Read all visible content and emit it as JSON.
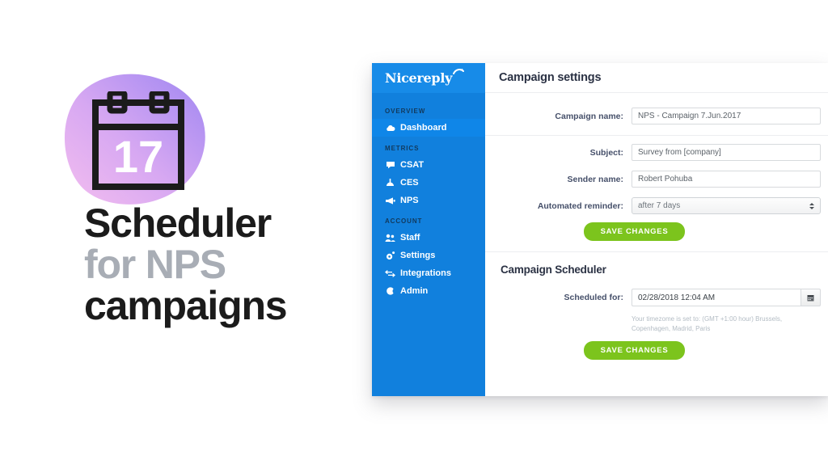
{
  "promo": {
    "calendar_day": "17",
    "headline_line1": "Scheduler",
    "headline_line2": "for NPS",
    "headline_line3": "campaigns",
    "colors": {
      "blob_pink": "#f0b9ec",
      "blob_purple": "#a28cf0",
      "headline_dark": "#1b1b1b",
      "headline_gray": "#a8adb5"
    }
  },
  "app": {
    "brand": {
      "name": "Nicereply"
    },
    "colors": {
      "sidebar_blue": "#1180dd",
      "brand_blue": "#178be8",
      "active_blue": "#0f86e8",
      "save_green": "#7cc41d",
      "title_navy": "#2b3244"
    },
    "sidebar": {
      "sections": [
        {
          "label": "OVERVIEW",
          "items": [
            {
              "label": "Dashboard",
              "icon": "cloud-icon",
              "active": true
            }
          ]
        },
        {
          "label": "METRICS",
          "items": [
            {
              "label": "CSAT",
              "icon": "speech-bubble-icon",
              "active": false
            },
            {
              "label": "CES",
              "icon": "gauge-icon",
              "active": false
            },
            {
              "label": "NPS",
              "icon": "megaphone-icon",
              "active": false
            }
          ]
        },
        {
          "label": "ACCOUNT",
          "items": [
            {
              "label": "Staff",
              "icon": "people-icon",
              "active": false
            },
            {
              "label": "Settings",
              "icon": "gear-icon",
              "active": false
            },
            {
              "label": "Integrations",
              "icon": "arrows-exchange-icon",
              "active": false
            },
            {
              "label": "Admin",
              "icon": "moon-icon",
              "active": false
            }
          ]
        }
      ]
    },
    "header": {
      "title": "Campaign settings"
    },
    "campaign_settings": {
      "fields": [
        {
          "label": "Campaign name:",
          "value": "NPS - Campaign 7.Jun.2017",
          "type": "text"
        },
        {
          "label": "Subject:",
          "value": "Survey from [company]",
          "type": "text"
        },
        {
          "label": "Sender name:",
          "value": "Robert Pohuba",
          "type": "text"
        },
        {
          "label": "Automated reminder:",
          "value": "after 7 days",
          "type": "select"
        }
      ],
      "save_label": "SAVE CHANGES"
    },
    "scheduler": {
      "title": "Campaign Scheduler",
      "scheduled_label": "Scheduled for:",
      "scheduled_value": "02/28/2018 12:04 AM",
      "calendar_icon": "calendar-icon",
      "timezone_note": "Your timezome is set to: (GMT +1:00 hour) Brussels, Copenhagen, Madrid, Paris",
      "save_label": "SAVE CHANGES"
    }
  }
}
